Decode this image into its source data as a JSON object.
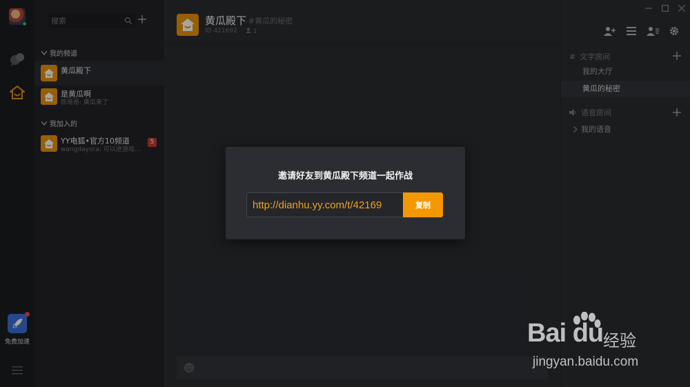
{
  "sidebar": {
    "boost_label": "免费加速"
  },
  "channel_list": {
    "search_placeholder": "搜索",
    "my_channels_title": "我的频道",
    "joined_title": "我加入的",
    "my_channels": [
      {
        "name": "黄瓜殿下",
        "sub": ""
      },
      {
        "name": "是黄瓜啊",
        "sub": "陈哥哥: 黄瓜来了"
      }
    ],
    "joined": [
      {
        "name": "YY电狐•官方10频道",
        "sub": "wangdaysca: 可以进游戏…",
        "badge": "5"
      }
    ]
  },
  "header": {
    "title": "黄瓜殿下",
    "topic": "#黄瓜的秘密",
    "id_text": "ID 421692",
    "member_count": "1"
  },
  "rooms": {
    "text_section": "文字房间",
    "text_rooms": [
      "我的大厅",
      "黄瓜的秘密"
    ],
    "voice_section": "语音房间",
    "voice_rooms": [
      "我的语音"
    ]
  },
  "modal": {
    "title": "邀请好友到黄瓜殿下频道一起作战",
    "link": "http://dianhu.yy.com/t/42169",
    "copy_label": "复制"
  },
  "watermark": {
    "logo": "Bai du",
    "brand": "经验",
    "url": "jingyan.baidu.com"
  },
  "colors": {
    "accent": "#f39800",
    "channel_logo": "#e8920c",
    "badge": "#c03a32",
    "online": "#3fbf62"
  }
}
